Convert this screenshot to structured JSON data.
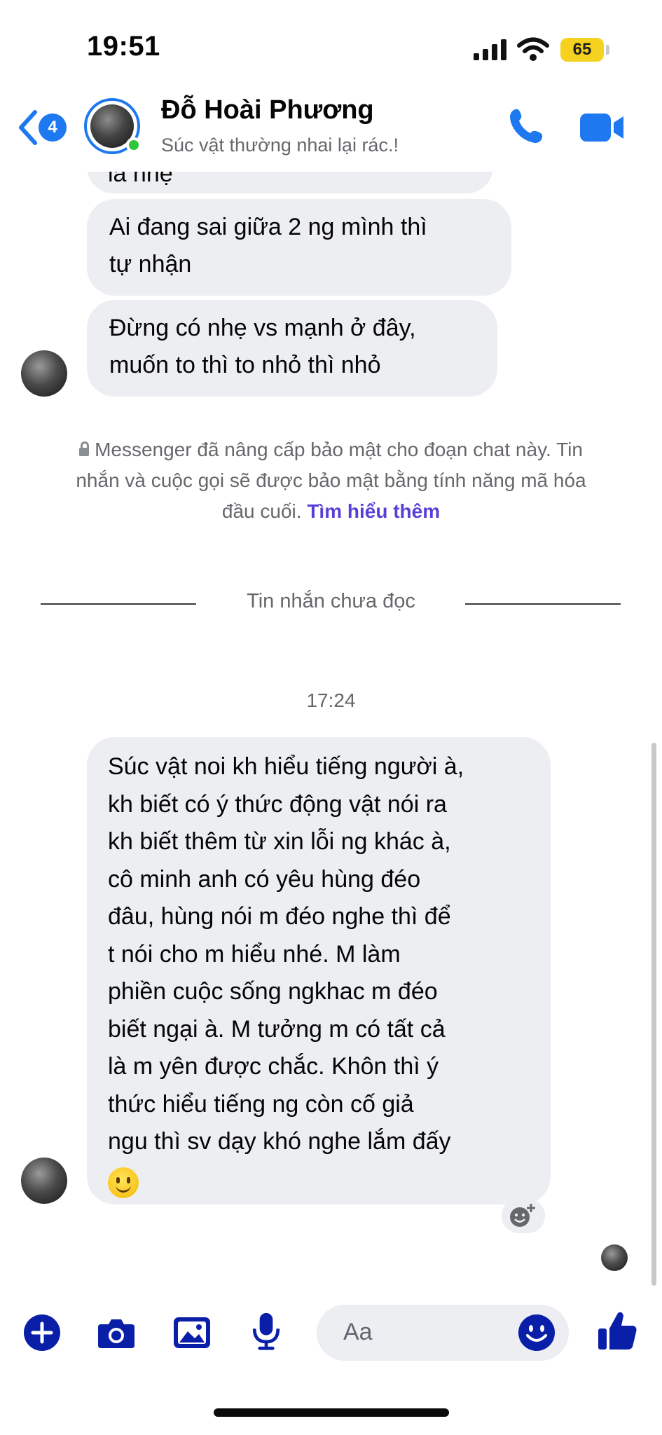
{
  "status_bar": {
    "time": "19:51",
    "battery": "65",
    "icons": [
      "signal-icon",
      "wifi-icon",
      "battery-icon"
    ]
  },
  "header": {
    "back_badge": "4",
    "contact_name": "Đỗ Hoài Phương",
    "contact_status": "Súc vật thường nhai lại rác.!"
  },
  "messages": {
    "partial_top": "là nhẹ",
    "msg1": {
      "line1": "Ai đang sai giữa 2 ng mình thì",
      "line2": "tự nhận"
    },
    "msg2": {
      "line1": "Đừng có nhẹ vs mạnh ở đây,",
      "line2": "muốn to thì to nhỏ thì nhỏ"
    },
    "big": {
      "lines": [
        "Súc vật noi kh hiểu tiếng người à,",
        "kh biết có ý thức động vật nói ra",
        "kh biết thêm từ xin lỗi ng khác à,",
        "cô minh anh có yêu hùng đéo",
        "đâu, hùng nói m đéo nghe thì để",
        "t nói cho m hiểu nhé. M làm",
        "phiền cuộc sống ngkhac m đéo",
        "biết ngại à. M tưởng m có tất cả",
        "là m yên được chắc. Khôn thì ý",
        "thức hiểu tiếng ng còn cố giả",
        "ngu thì sv dạy khó nghe lắm đấy"
      ]
    }
  },
  "notice": {
    "line1": "Messenger đã nâng cấp bảo mật cho đoạn chat này. Tin",
    "line2": "nhắn và cuộc gọi sẽ được bảo mật bằng tính năng mã hóa",
    "line3_prefix": "đầu cuối.",
    "link": "Tìm hiểu thêm"
  },
  "divider_label": "Tin nhắn chưa đọc",
  "timestamp": "17:24",
  "composer": {
    "placeholder": "Aa"
  },
  "colors": {
    "accent": "#1e78f0",
    "composer_accent": "#0a1fa8",
    "bubble_bg": "#eceef2",
    "online": "#2fc53a",
    "link": "#5a3fd6"
  }
}
